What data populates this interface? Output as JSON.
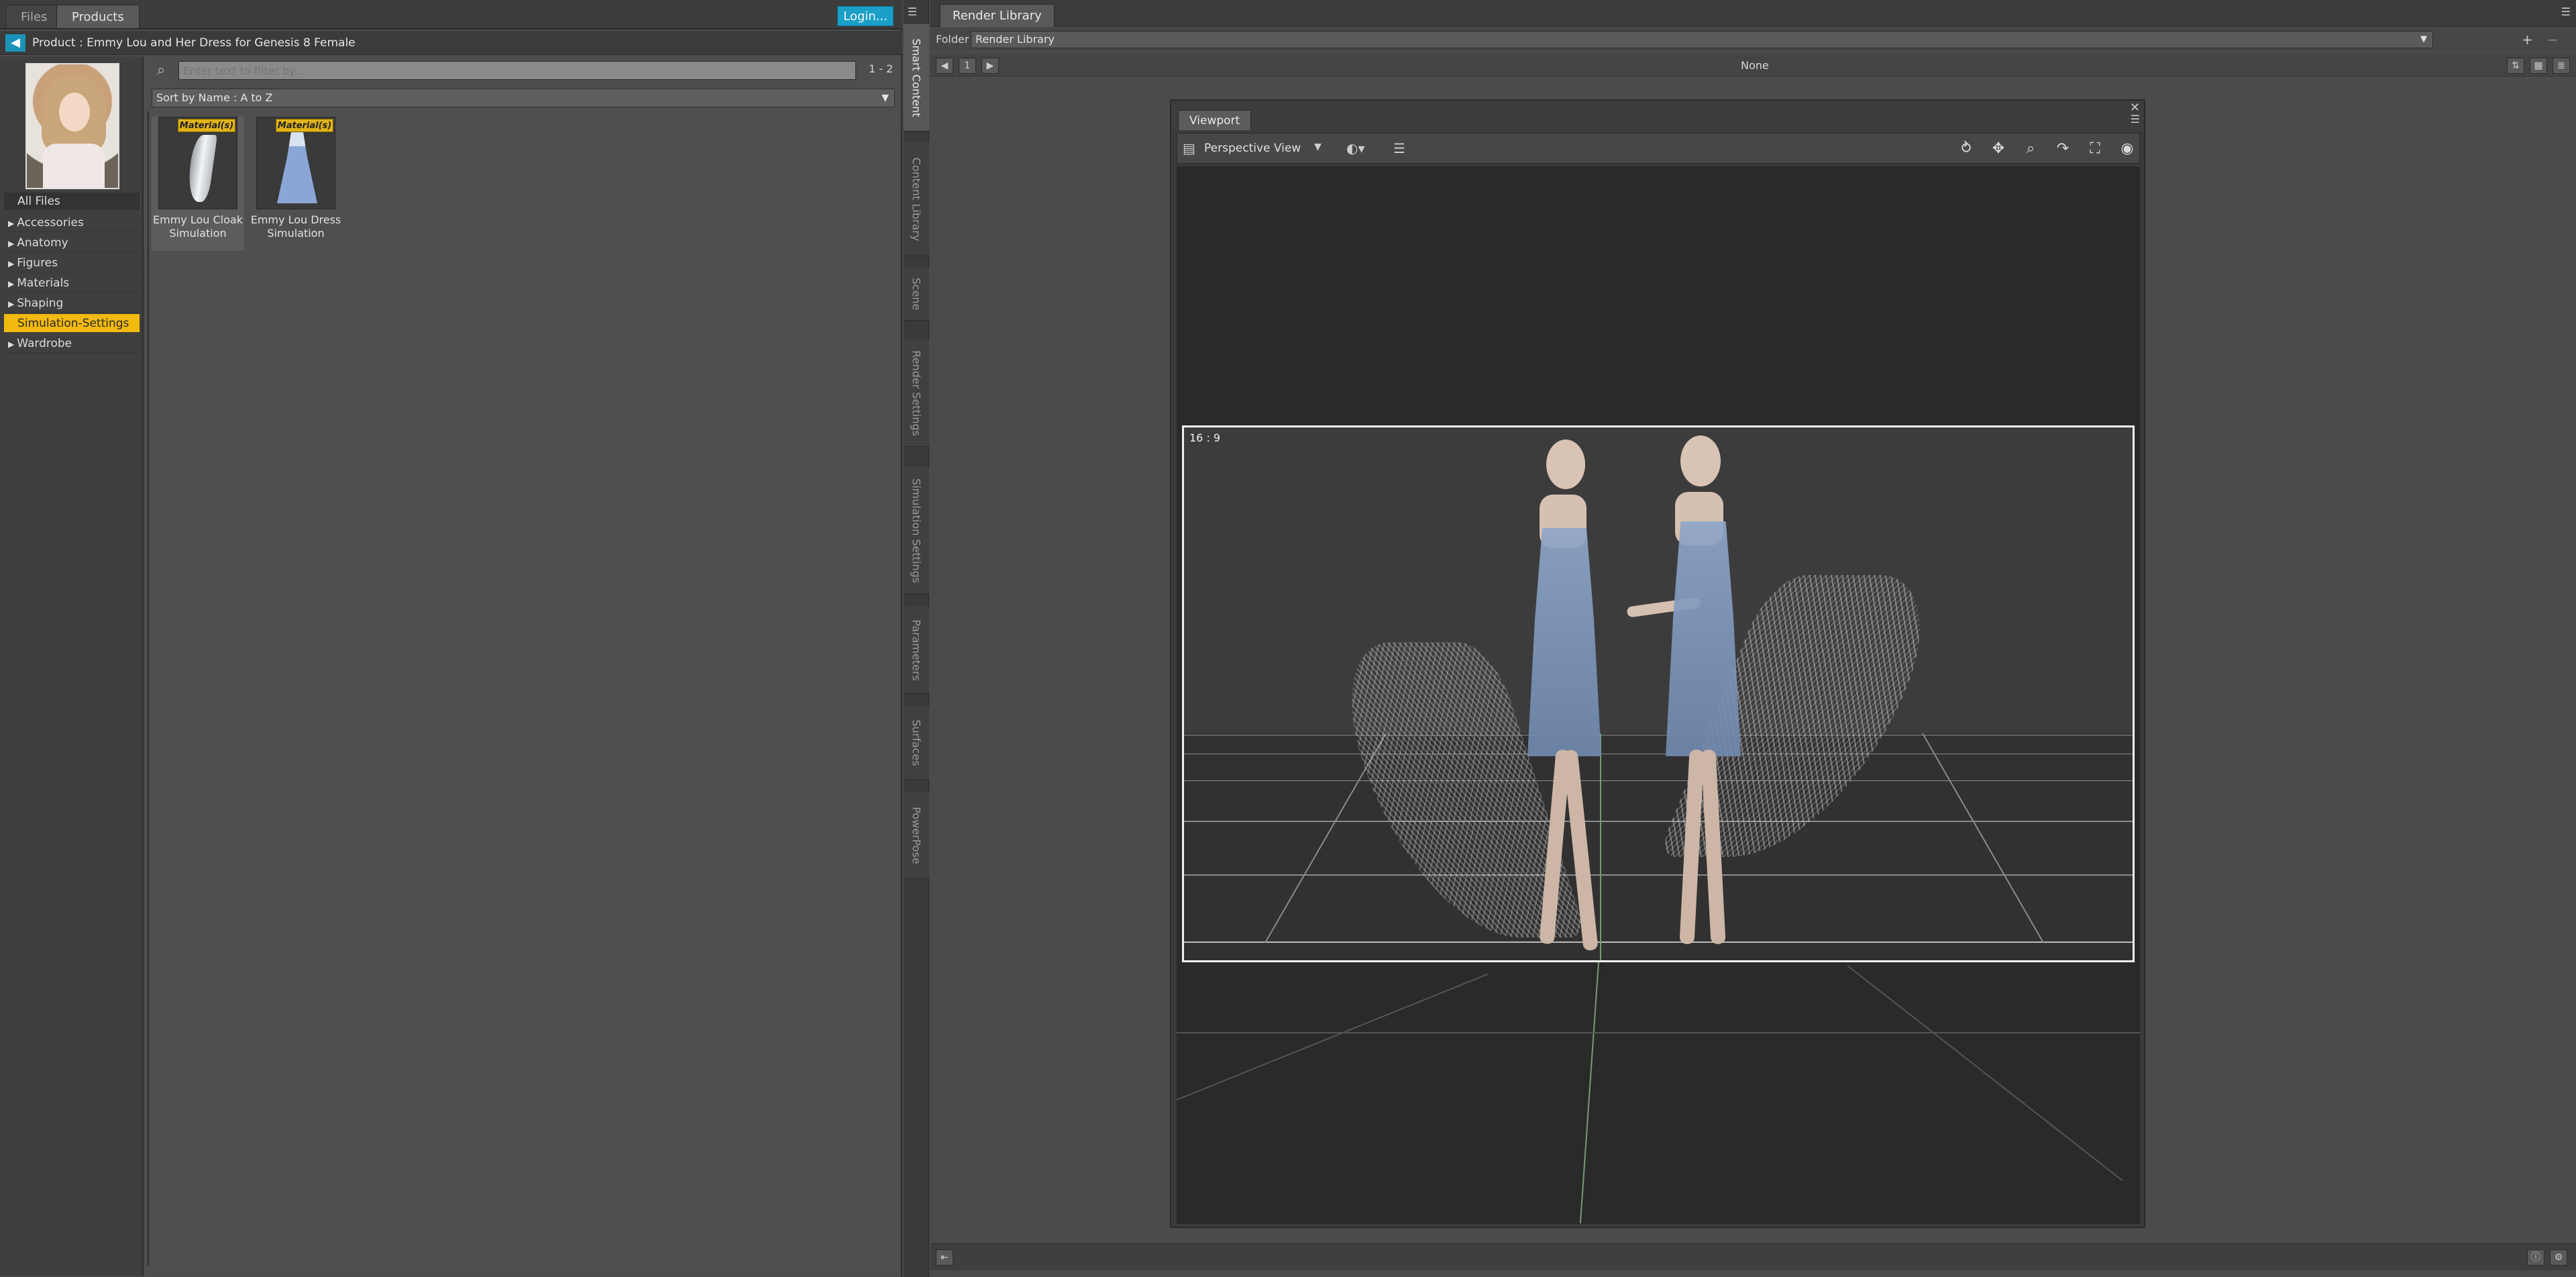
{
  "left_tabs": [
    "Files",
    "Products"
  ],
  "login_label": "Login...",
  "product_bar": {
    "text": "Product :  Emmy Lou and Her Dress for Genesis 8 Female"
  },
  "all_files_label": "All Files",
  "categories": [
    {
      "label": "Accessories",
      "expandable": true
    },
    {
      "label": "Anatomy",
      "expandable": true
    },
    {
      "label": "Figures",
      "expandable": true
    },
    {
      "label": "Materials",
      "expandable": true
    },
    {
      "label": "Shaping",
      "expandable": true
    },
    {
      "label": "Simulation-Settings",
      "expandable": false,
      "selected": true
    },
    {
      "label": "Wardrobe",
      "expandable": true
    }
  ],
  "filter": {
    "placeholder": "Enter text to filter by...",
    "count": "1 - 2"
  },
  "sort_label": "Sort by Name : A to Z",
  "items": [
    {
      "line1": "Emmy Lou Cloak",
      "line2": "Simulation",
      "badge": "Material(s)"
    },
    {
      "line1": "Emmy Lou Dress",
      "line2": "Simulation",
      "badge": "Material(s)"
    }
  ],
  "side_tabs": [
    "Smart Content",
    "Content Library",
    "Scene",
    "Render Settings",
    "Simulation Settings",
    "Parameters",
    "Surfaces",
    "PowerPose"
  ],
  "render_library": {
    "tab_label": "Render Library",
    "folder_label": "Folder :",
    "folder_value": "Render Library",
    "page": "1",
    "none_label": "None"
  },
  "viewport": {
    "tab_label": "Viewport",
    "view_label": "Perspective View",
    "aspect_label": "16 : 9"
  },
  "colors": {
    "accent_selected": "#f2b90e",
    "login": "#1aa0c8",
    "badge": "#e2b418"
  }
}
